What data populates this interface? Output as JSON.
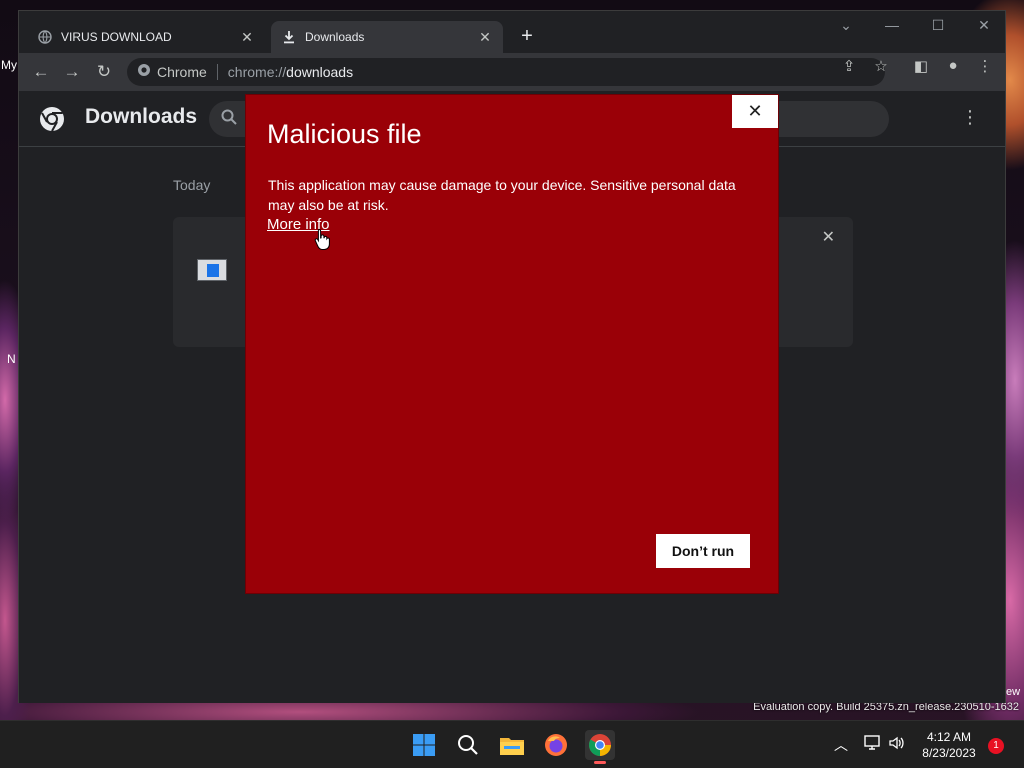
{
  "desktop": {
    "left_label_top": "My",
    "left_label_mid": "N",
    "right_label": "ew",
    "evaluation_text": "Evaluation copy. Build 25375.zn_release.230510-1632"
  },
  "browser": {
    "tabs": [
      {
        "title": "VIRUS DOWNLOAD",
        "icon": "globe-icon",
        "active": false
      },
      {
        "title": "Downloads",
        "icon": "download-icon",
        "active": true
      }
    ],
    "new_tab_symbol": "+",
    "omnibox": {
      "site_label": "Chrome",
      "url_scheme": "chrome://",
      "url_path": "downloads"
    }
  },
  "downloads_page": {
    "title": "Downloads",
    "section_label": "Today"
  },
  "dialog": {
    "title": "Malicious file",
    "message": "This application may cause damage to your device. Sensitive personal data may also be at risk.",
    "link_text": "More info",
    "primary_button": "Don’t run",
    "close_symbol": "✕",
    "background_color": "#9a0007"
  },
  "taskbar": {
    "apps": [
      "start-icon",
      "search-icon",
      "file-explorer-icon",
      "firefox-icon",
      "chrome-icon"
    ],
    "time": "4:12 AM",
    "date": "8/23/2023",
    "notification_count": "1"
  }
}
